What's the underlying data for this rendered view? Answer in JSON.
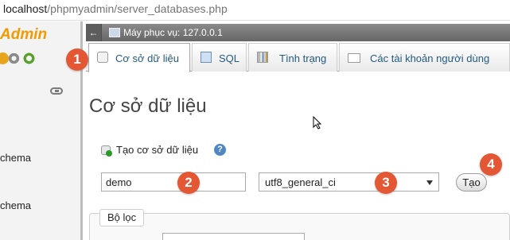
{
  "browser": {
    "url_host": "localhost",
    "url_path": "/phpmyadmin/server_databases.php"
  },
  "sidebar": {
    "logo_text": "Admin",
    "items": [
      {
        "label": "chema"
      },
      {
        "label": "chema"
      }
    ]
  },
  "server_header": {
    "back_label": "←",
    "title": "Máy phục vụ: 127.0.0.1"
  },
  "tabs": [
    {
      "label": "Cơ sở dữ liệu",
      "active": true
    },
    {
      "label": "SQL",
      "active": false
    },
    {
      "label": "Tình trạng",
      "active": false
    },
    {
      "label": "Các tài khoản người dùng",
      "active": false
    }
  ],
  "main": {
    "page_title": "Cơ sở dữ liệu",
    "create": {
      "heading": "Tạo cơ sở dữ liệu",
      "help_symbol": "?",
      "db_name_value": "demo",
      "collation_value": "utf8_general_ci",
      "create_button_label": "Tạo"
    },
    "filter": {
      "legend": "Bộ lọc"
    }
  },
  "annotations": [
    "1",
    "2",
    "3",
    "4"
  ],
  "colors": {
    "marker": "#e45735",
    "logo": "#f29a00",
    "tab_text": "#235a81",
    "server_bar": "#767676"
  }
}
